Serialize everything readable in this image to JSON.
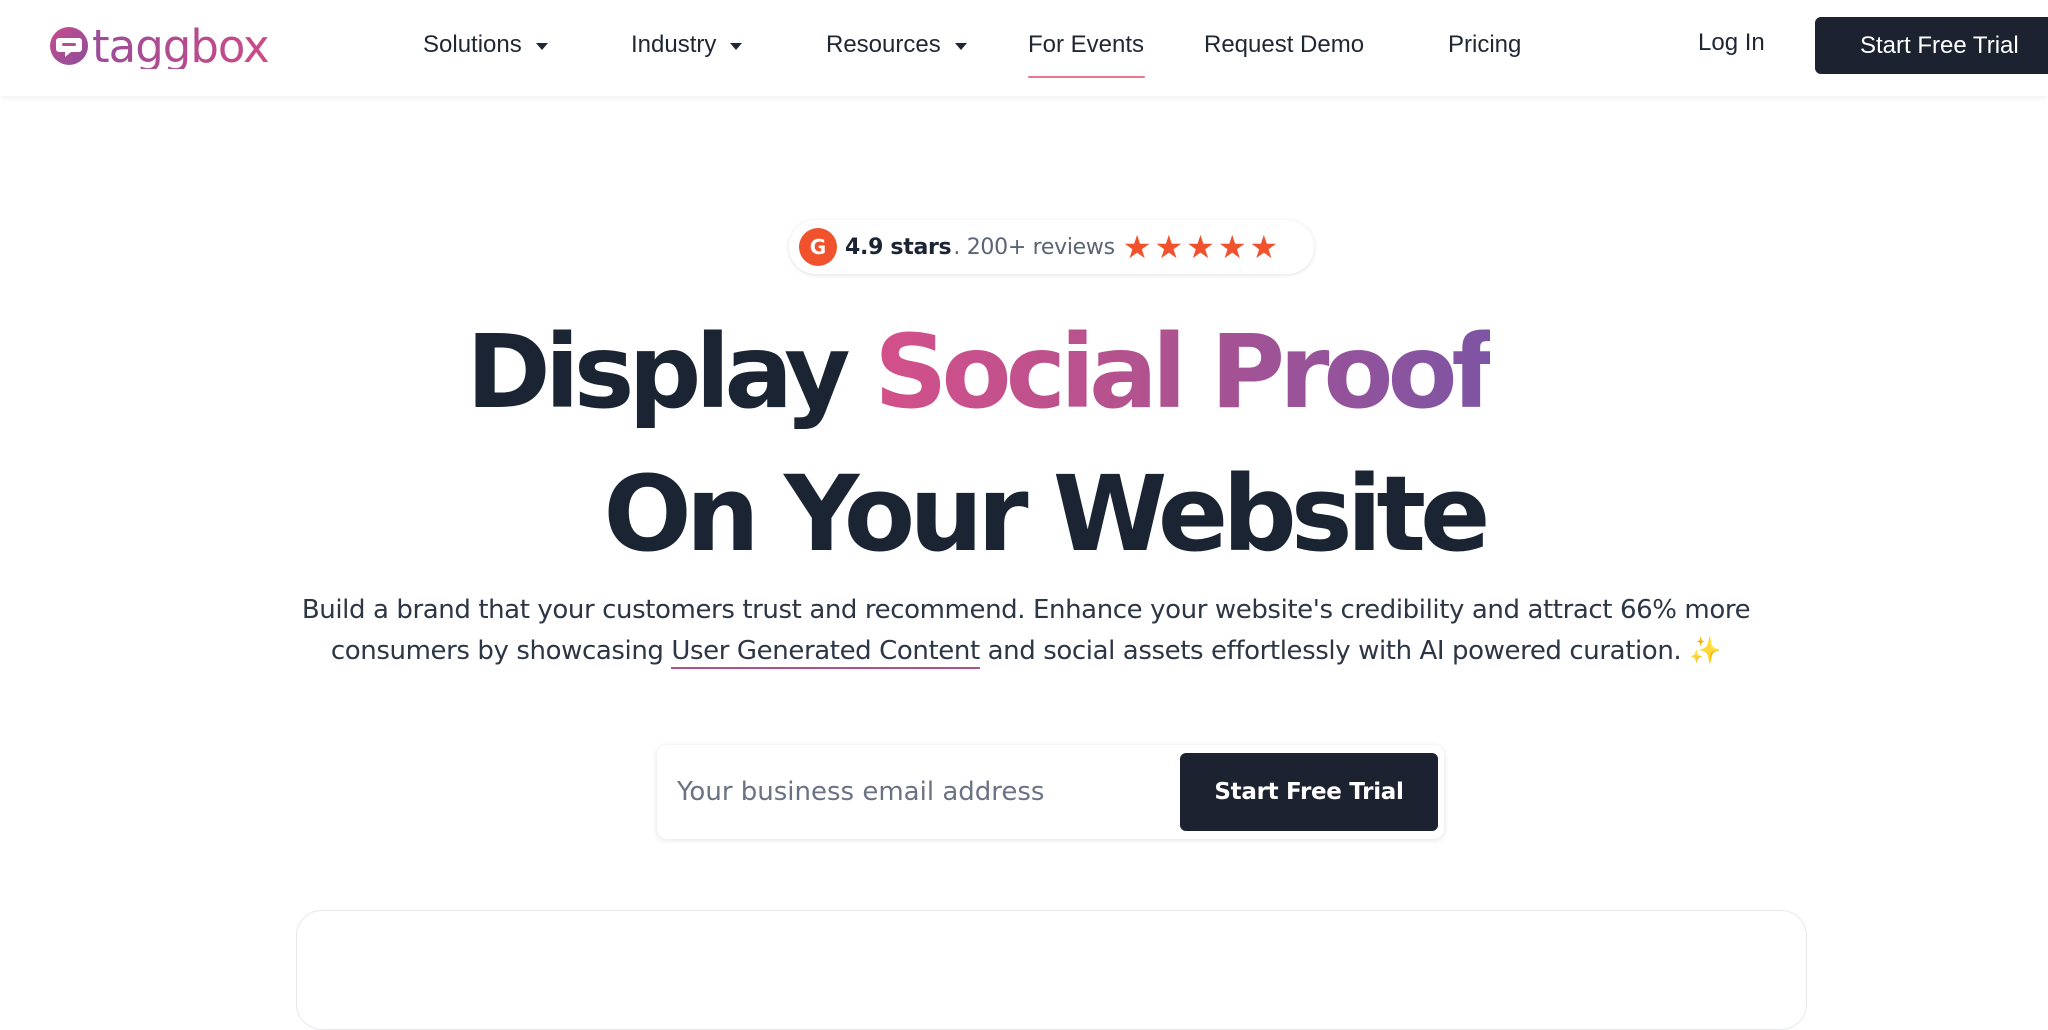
{
  "logo": {
    "text": "taggbox"
  },
  "nav": {
    "items": [
      {
        "label": "Solutions",
        "dropdown": true
      },
      {
        "label": "Industry",
        "dropdown": true
      },
      {
        "label": "Resources",
        "dropdown": true
      },
      {
        "label": "For Events",
        "dropdown": false,
        "active": true
      },
      {
        "label": "Request Demo",
        "dropdown": false
      },
      {
        "label": "Pricing",
        "dropdown": false
      }
    ],
    "login_label": "Log In",
    "cta_label": "Start Free Trial"
  },
  "rating": {
    "logo_text": "G",
    "stars_text": "4.9 stars",
    "reviews_text": ". 200+ reviews",
    "star_count": 5,
    "star_color": "#f0522d"
  },
  "hero": {
    "headline_line1_plain": "Display ",
    "headline_line1_gradient": "Social Proof",
    "headline_line2": "On Your Website",
    "subcopy_before_link": "Build a brand that your customers trust and recommend. Enhance your website's credibility and attract 66% more consumers by showcasing ",
    "subcopy_link": "User Generated Content",
    "subcopy_after_link": " and social assets effortlessly with AI powered curation. ",
    "sparkle": "✨"
  },
  "signup": {
    "email_placeholder": "Your business email address",
    "email_value": "",
    "cta_label": "Start Free Trial"
  },
  "colors": {
    "dark": "#1c2230",
    "text": "#1b2433",
    "gradient_start": "#d4508a",
    "gradient_end": "#7d54a4",
    "active_underline": "#e8768d"
  }
}
